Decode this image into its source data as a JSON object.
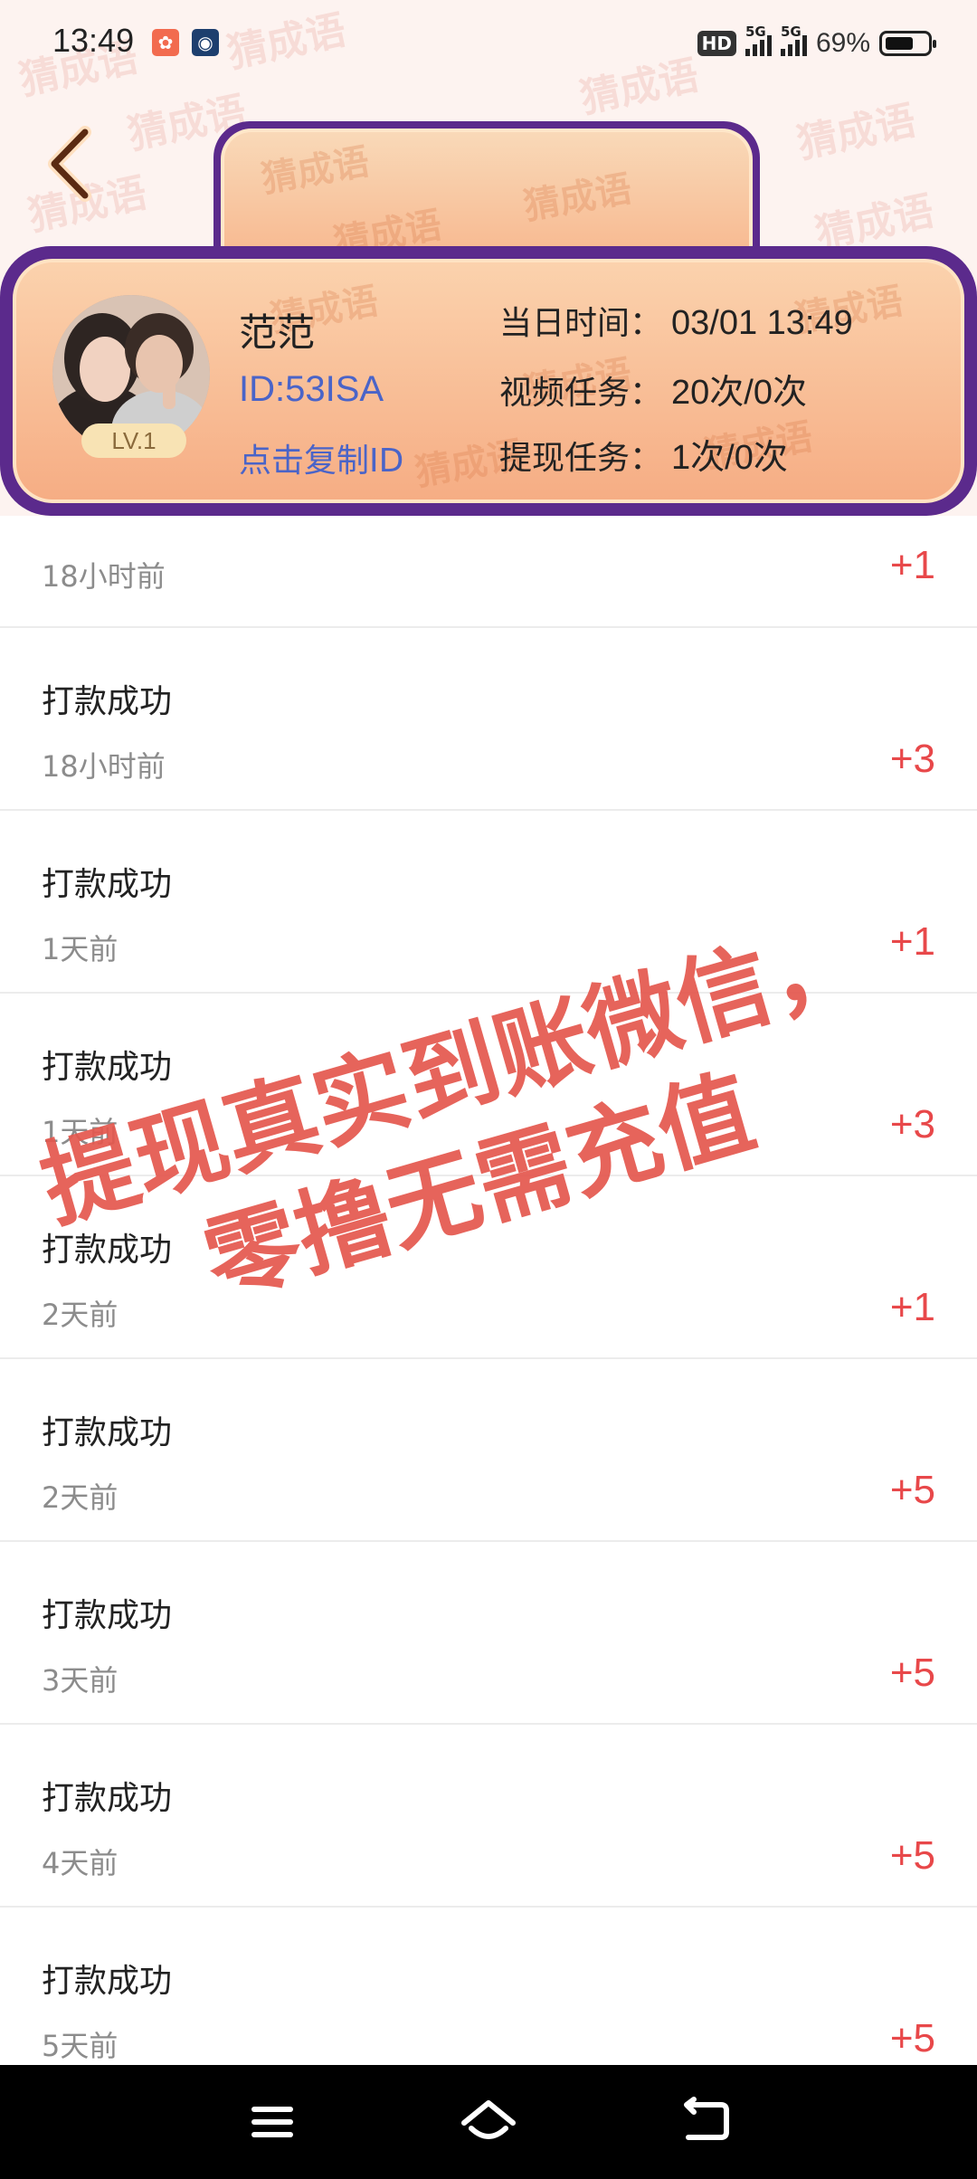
{
  "status_bar": {
    "time": "13:49",
    "hd_label": "HD",
    "signal_label_1": "5G",
    "signal_label_2": "5G",
    "battery_percent": "69%",
    "battery_level": 0.69
  },
  "background": {
    "watermark_text": "猜成语"
  },
  "user_card": {
    "name": "范范",
    "id_text": "ID:53ISA",
    "copy_label": "点击复制ID",
    "level": "LV.1",
    "date_label": "当日时间：",
    "date_value": "03/01 13:49",
    "video_task_label": "视频任务：",
    "video_task_value": "20次/0次",
    "withdraw_task_label": "提现任务：",
    "withdraw_task_value": "1次/0次"
  },
  "records": [
    {
      "title": "",
      "time": "18小时前",
      "amount": "+1"
    },
    {
      "title": "打款成功",
      "time": "18小时前",
      "amount": "+3"
    },
    {
      "title": "打款成功",
      "time": "1天前",
      "amount": "+1"
    },
    {
      "title": "打款成功",
      "time": "1天前",
      "amount": "+3"
    },
    {
      "title": "打款成功",
      "time": "2天前",
      "amount": "+1"
    },
    {
      "title": "打款成功",
      "time": "2天前",
      "amount": "+5"
    },
    {
      "title": "打款成功",
      "time": "3天前",
      "amount": "+5"
    },
    {
      "title": "打款成功",
      "time": "4天前",
      "amount": "+5"
    },
    {
      "title": "打款成功",
      "time": "5天前",
      "amount": "+5"
    }
  ],
  "overlay": {
    "line1": "提现真实到账微信，",
    "line2": "零撸无需充值"
  },
  "nav": {
    "menu_icon": "menu-icon",
    "home_icon": "home-icon",
    "back_icon": "back-icon"
  },
  "colors": {
    "card_border": "#5b2a8c",
    "accent_blue": "#4a64c8",
    "amount_red": "#e8484a",
    "overlay_red": "#e4574e"
  }
}
